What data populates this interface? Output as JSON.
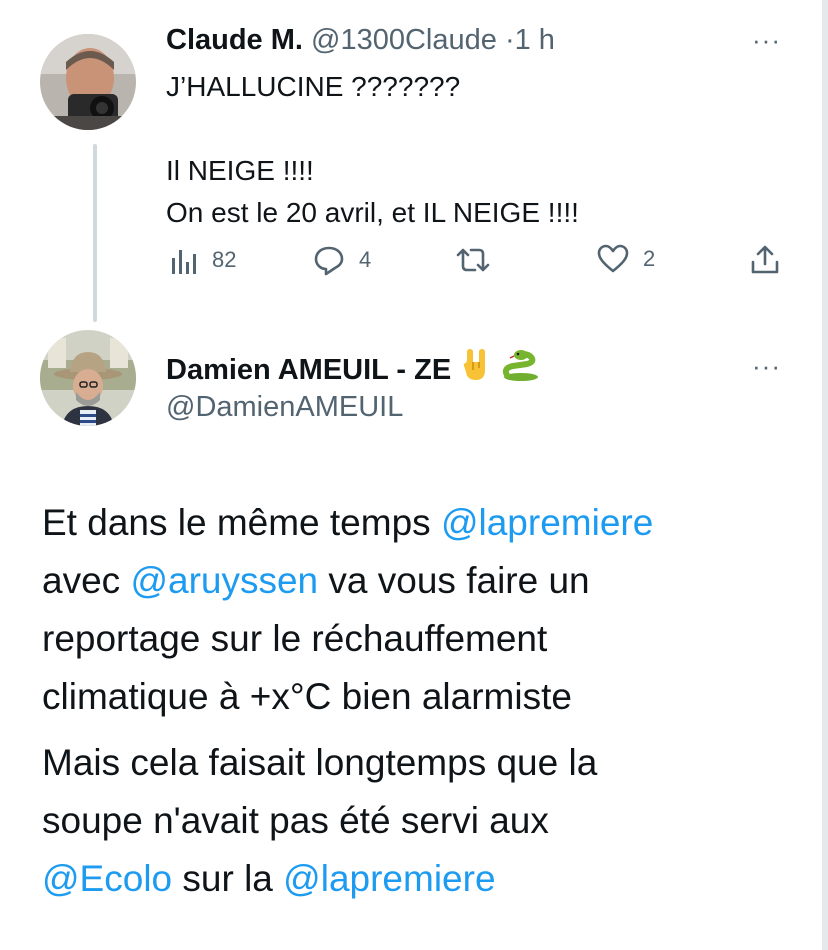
{
  "reply_tweet": {
    "author_name": "Claude M.",
    "handle": "@1300Claude",
    "separator": "·",
    "time": "1 h",
    "more": "···",
    "text_lines": [
      "J’HALLUCINE ???????",
      "",
      "Il NEIGE !!!!",
      "On est le 20 avril, et IL NEIGE !!!!"
    ],
    "actions": {
      "views": "82",
      "replies": "4",
      "retweets": "",
      "likes": "2"
    },
    "icons": [
      "views-icon",
      "reply-icon",
      "retweet-icon",
      "like-icon",
      "share-icon"
    ]
  },
  "main_tweet": {
    "author_name": "Damien AMEUIL - ZE",
    "name_emojis": [
      "🤘",
      "🐍"
    ],
    "handle": "@DamienAMEUIL",
    "more": "···",
    "body": {
      "para1": {
        "l1_a": "Et dans le même temps ",
        "l1_mention": "@lapremiere",
        "l2_a": "avec ",
        "l2_mention": "@aruyssen",
        "l2_b": " va vous faire un",
        "l3": "reportage sur le réchauffement",
        "l4": "climatique à +x°C bien alarmiste"
      },
      "para2": {
        "l1": "Mais cela faisait longtemps que la",
        "l2": "soupe n'avait pas été servi aux",
        "l3_mention": "@Ecolo",
        "l3_b": " sur la ",
        "l3_mention2": "@lapremiere"
      }
    }
  },
  "colors": {
    "text": "#0f1419",
    "muted": "#536471",
    "link": "#1d9bf0",
    "thread_line": "#cfd9de"
  }
}
